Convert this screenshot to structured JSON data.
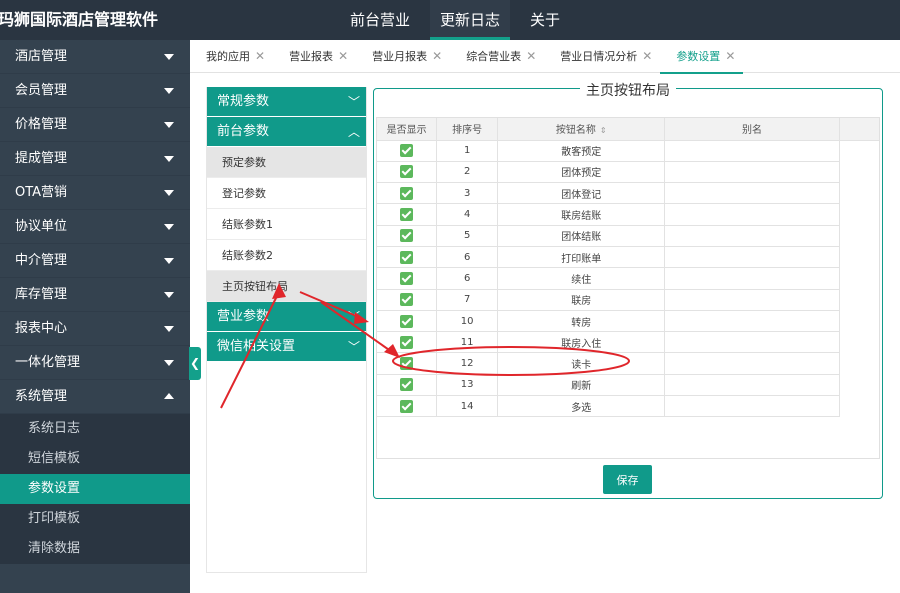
{
  "app": {
    "title": "玛狮国际酒店管理软件"
  },
  "topnav": [
    {
      "label": "前台营业",
      "active": false
    },
    {
      "label": "更新日志",
      "active": true
    },
    {
      "label": "关于",
      "active": false
    }
  ],
  "sidebar": {
    "menu": [
      {
        "label": "酒店管理"
      },
      {
        "label": "会员管理"
      },
      {
        "label": "价格管理"
      },
      {
        "label": "提成管理"
      },
      {
        "label": "OTA营销"
      },
      {
        "label": "协议单位"
      },
      {
        "label": "中介管理"
      },
      {
        "label": "库存管理"
      },
      {
        "label": "报表中心"
      },
      {
        "label": "一体化管理"
      },
      {
        "label": "系统管理"
      }
    ],
    "submenu": [
      {
        "label": "系统日志"
      },
      {
        "label": "短信模板"
      },
      {
        "label": "参数设置",
        "active": true
      },
      {
        "label": "打印模板"
      },
      {
        "label": "清除数据"
      }
    ],
    "collapse_glyph": "❮"
  },
  "tabs": [
    {
      "label": "我的应用"
    },
    {
      "label": "营业报表"
    },
    {
      "label": "营业月报表"
    },
    {
      "label": "综合营业表"
    },
    {
      "label": "营业日情况分析"
    },
    {
      "label": "参数设置",
      "active": true
    }
  ],
  "tab_close": "✕",
  "left_panel": {
    "sections": [
      {
        "label": "常规参数",
        "expanded": false
      },
      {
        "label": "前台参数",
        "expanded": true
      },
      {
        "label": "营业参数",
        "expanded": false
      },
      {
        "label": "微信相关设置",
        "expanded": false
      }
    ],
    "items": [
      "预定参数",
      "登记参数",
      "结账参数1",
      "结账参数2",
      "主页按钮布局"
    ]
  },
  "layout_panel": {
    "title": "主页按钮布局",
    "columns": {
      "show": "是否显示",
      "order": "排序号",
      "name": "按钮名称",
      "alias": "别名"
    },
    "rows": [
      {
        "order": "1",
        "name": "散客预定",
        "alias": "",
        "checked": true
      },
      {
        "order": "2",
        "name": "团体预定",
        "alias": "",
        "checked": true
      },
      {
        "order": "3",
        "name": "团体登记",
        "alias": "",
        "checked": true
      },
      {
        "order": "4",
        "name": "联房结账",
        "alias": "",
        "checked": true
      },
      {
        "order": "5",
        "name": "团体结账",
        "alias": "",
        "checked": true
      },
      {
        "order": "6",
        "name": "打印账单",
        "alias": "",
        "checked": true
      },
      {
        "order": "6",
        "name": "续住",
        "alias": "",
        "checked": true
      },
      {
        "order": "7",
        "name": "联房",
        "alias": "",
        "checked": true
      },
      {
        "order": "10",
        "name": "转房",
        "alias": "",
        "checked": true
      },
      {
        "order": "11",
        "name": "联房入住",
        "alias": "",
        "checked": true
      },
      {
        "order": "12",
        "name": "读卡",
        "alias": "",
        "checked": true
      },
      {
        "order": "13",
        "name": "刷新",
        "alias": "",
        "checked": true
      },
      {
        "order": "14",
        "name": "多选",
        "alias": "",
        "checked": true
      }
    ],
    "save_label": "保存"
  },
  "annotation_color": "#e0262b"
}
